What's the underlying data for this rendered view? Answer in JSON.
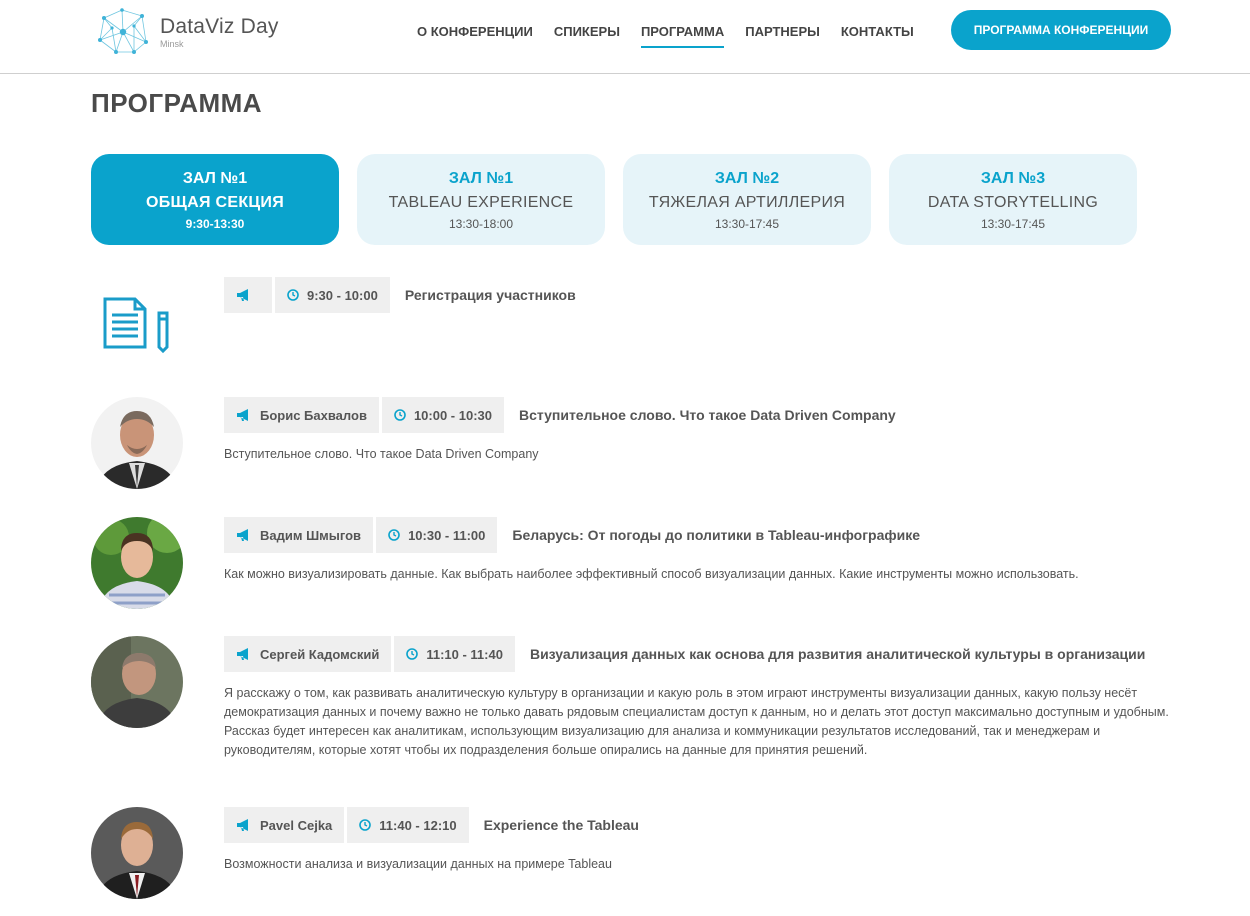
{
  "header": {
    "logo_name": "DataViz Day",
    "logo_city": "Minsk",
    "nav": [
      {
        "label": "О КОНФЕРЕНЦИИ"
      },
      {
        "label": "СПИКЕРЫ"
      },
      {
        "label": "ПРОГРАММА",
        "active": true
      },
      {
        "label": "ПАРТНЕРЫ"
      },
      {
        "label": "КОНТАКТЫ"
      }
    ],
    "cta_label": "ПРОГРАММА КОНФЕРЕНЦИИ"
  },
  "page_title": "ПРОГРАММА",
  "tabs": [
    {
      "hall": "ЗАЛ №1",
      "name": "ОБЩАЯ СЕКЦИЯ",
      "time": "9:30-13:30",
      "active": true
    },
    {
      "hall": "ЗАЛ №1",
      "name": "TABLEAU EXPERIENCE",
      "time": "13:30-18:00"
    },
    {
      "hall": "ЗАЛ №2",
      "name": "ТЯЖЕЛАЯ АРТИЛЛЕРИЯ",
      "time": "13:30-17:45"
    },
    {
      "hall": "ЗАЛ №3",
      "name": "DATA STORYTELLING",
      "time": "13:30-17:45"
    }
  ],
  "agenda": [
    {
      "speaker": "",
      "time": "9:30 - 10:00",
      "title": "Регистрация участников",
      "description": ""
    },
    {
      "speaker": "Борис Бахвалов",
      "time": "10:00 - 10:30",
      "title": "Вступительное слово. Что такое Data Driven Company",
      "description": "Вступительное слово. Что такое Data Driven Company"
    },
    {
      "speaker": "Вадим Шмыгов",
      "time": "10:30 - 11:00",
      "title": "Беларусь: От погоды до политики в Tableau-инфографике",
      "description": "Как можно визуализировать данные. Как выбрать наиболее эффективный способ визуализации данных. Какие инструменты можно использовать."
    },
    {
      "speaker": "Сергей Кадомский",
      "time": "11:10 - 11:40",
      "title": "Визуализация данных как основа для развития аналитической культуры в организации",
      "description": "Я расскажу о том, как развивать аналитическую культуру в организации и какую роль в этом играют инструменты визуализации данных, какую пользу несёт демократизация данных и почему важно не только давать рядовым специалистам доступ к данным, но и делать этот доступ максимально доступным и удобным.",
      "description2": "Рассказ будет интересен как аналитикам, использующим визуализацию для анализа и коммуникации результатов исследований, так и менеджерам и руководителям, которые хотят чтобы их подразделения больше опирались на данные для принятия решений."
    },
    {
      "speaker": "Pavel Cejka",
      "time": "11:40 - 12:10",
      "title": "Experience the Tableau",
      "description": "Возможности анализа и визуализации данных на примере Tableau"
    }
  ],
  "colors": {
    "accent": "#0aa3cc",
    "tab_bg": "#e6f4f9",
    "chip_bg": "#efefef"
  }
}
